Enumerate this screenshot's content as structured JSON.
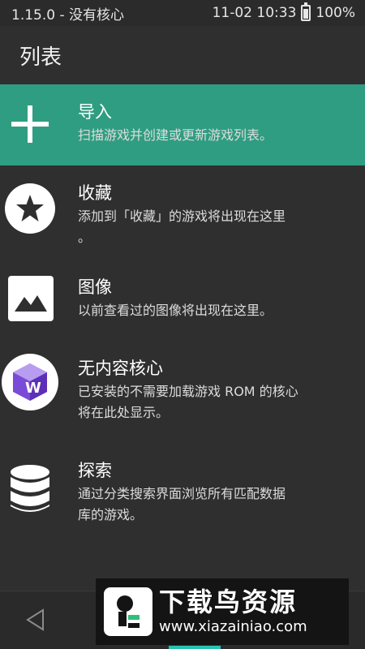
{
  "status_bar": {
    "left_text": "1.15.0 - 没有核心",
    "datetime": "11-02 10:33",
    "battery": "100%"
  },
  "app_bar": {
    "title": "列表"
  },
  "list": [
    {
      "icon": "plus-icon",
      "title": "导入",
      "desc_lines": [
        "扫描游戏并创建或更新游戏列表。"
      ],
      "active": true,
      "accent": "#2f9d82"
    },
    {
      "icon": "star-icon",
      "title": "收藏",
      "desc_lines": [
        "添加到「收藏」的游戏将出现在这里",
        "。"
      ],
      "active": false
    },
    {
      "icon": "image-icon",
      "title": "图像",
      "desc_lines": [
        "以前查看过的图像将出现在这里。"
      ],
      "active": false
    },
    {
      "icon": "core-icon",
      "title": "无内容核心",
      "desc_lines": [
        "已安装的不需要加载游戏 ROM 的核心",
        "将在此处显示。"
      ],
      "active": false
    },
    {
      "icon": "database-icon",
      "title": "探索",
      "desc_lines": [
        "通过分类搜索界面浏览所有匹配数据",
        "库的游戏。"
      ],
      "active": false
    }
  ],
  "watermark": {
    "title": "下载鸟资源",
    "url": "www.xiazainiao.com"
  },
  "colors": {
    "background": "#2f2f2f",
    "accent": "#2f9d82",
    "nav_accent": "#28c2b0"
  }
}
